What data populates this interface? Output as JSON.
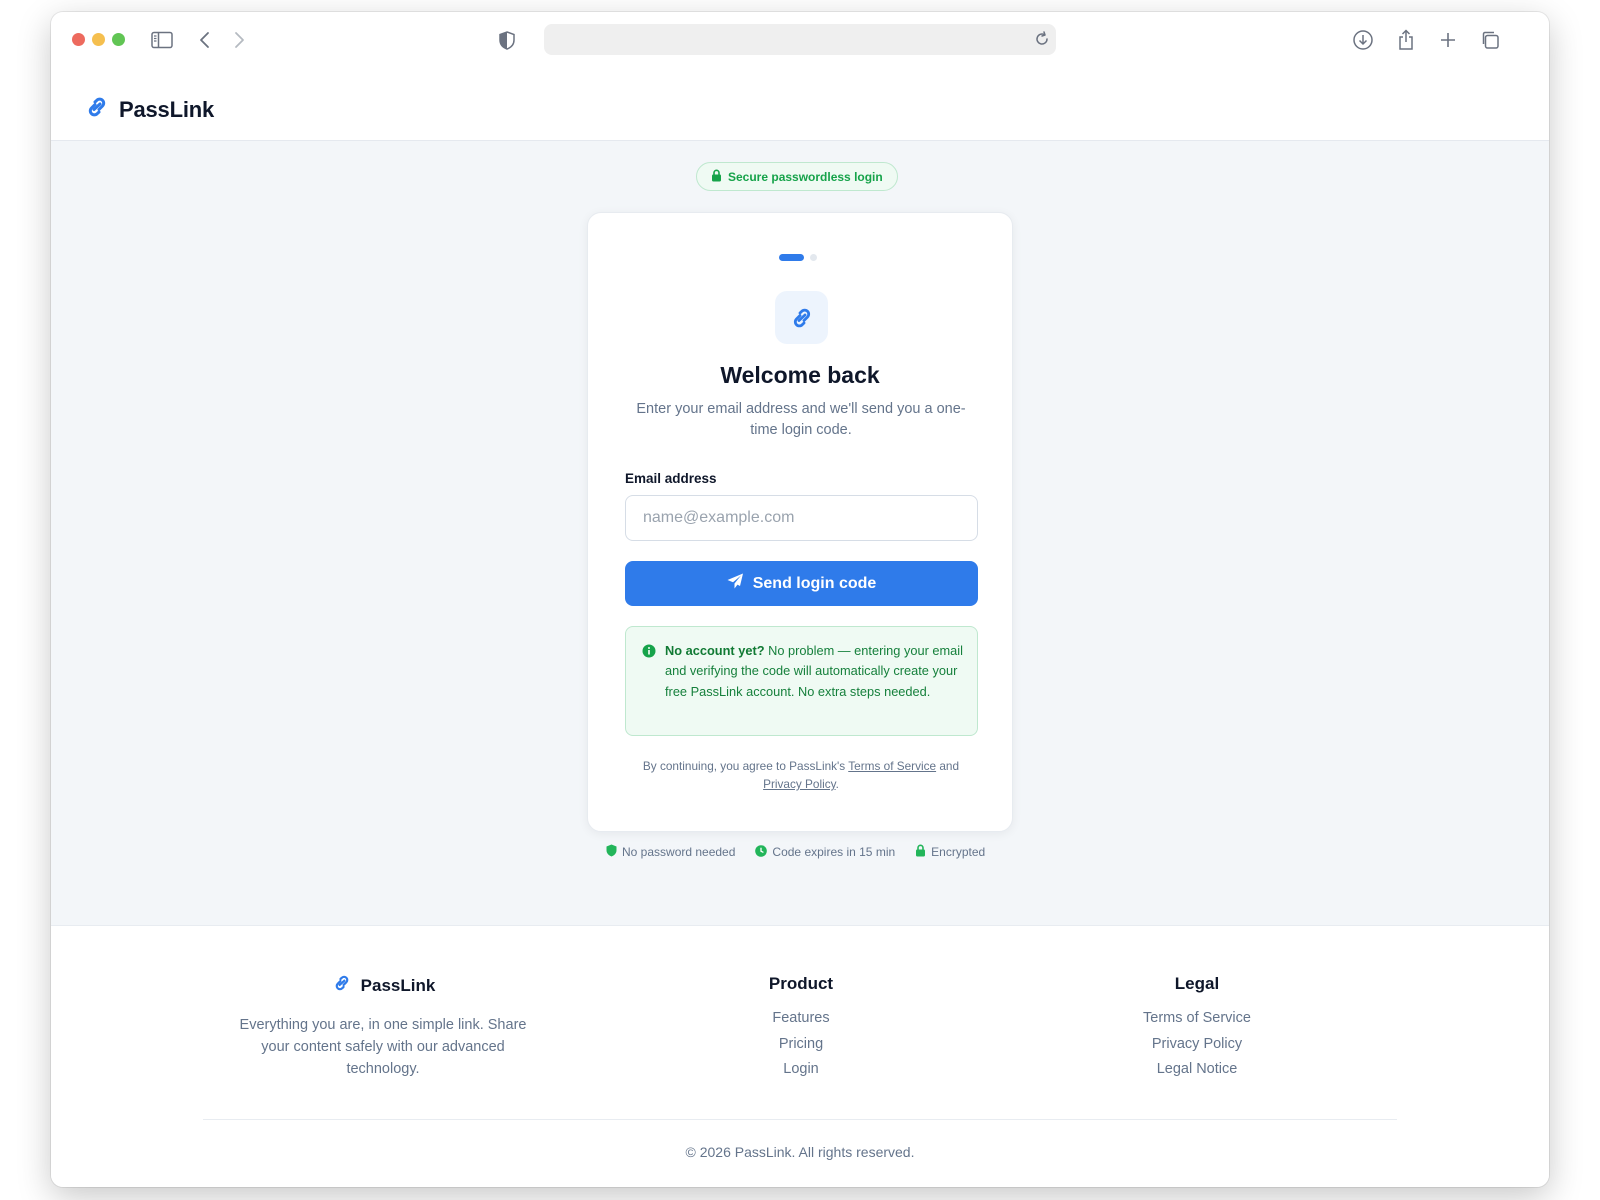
{
  "browser": {
    "address": "",
    "icons": [
      "sidebar-icon",
      "back-icon",
      "forward-icon",
      "shield-icon",
      "reload-icon",
      "download-icon",
      "share-icon",
      "new-tab-icon",
      "tabs-icon"
    ]
  },
  "header": {
    "brand": "PassLink"
  },
  "main": {
    "secure_badge": "Secure passwordless login",
    "card": {
      "step_current": 1,
      "step_total": 2,
      "title": "Welcome back",
      "subtitle": "Enter your email address and we'll send you a one-time login code.",
      "email_label": "Email address",
      "email_placeholder": "name@example.com",
      "email_value": "",
      "send_button": "Send login code",
      "info_strong": "No account yet?",
      "info_text": " No problem — entering your email and verifying the code will automatically create your free PassLink account. No extra steps needed.",
      "legal_prefix": "By continuing, you agree to PassLink's ",
      "terms_link": "Terms of Service",
      "legal_and": " and ",
      "privacy_link": "Privacy Policy",
      "legal_suffix": "."
    },
    "features": [
      {
        "icon": "shield-icon",
        "label": "No password needed"
      },
      {
        "icon": "clock-icon",
        "label": "Code expires in 15 min"
      },
      {
        "icon": "lock-icon",
        "label": "Encrypted"
      }
    ]
  },
  "footer": {
    "brand": "PassLink",
    "description": "Everything you are, in one simple link. Share your content safely with our advanced technology.",
    "product_heading": "Product",
    "product_links": [
      "Features",
      "Pricing",
      "Login"
    ],
    "legal_heading": "Legal",
    "legal_links": [
      "Terms of Service",
      "Privacy Policy",
      "Legal Notice"
    ],
    "copyright": "© 2026 PassLink. All rights reserved."
  },
  "colors": {
    "accent": "#2f7bea",
    "success": "#16a34a",
    "success_bg": "#effaf3",
    "page_bg": "#f3f6f9",
    "text": "#0f172a",
    "muted": "#64748b"
  }
}
